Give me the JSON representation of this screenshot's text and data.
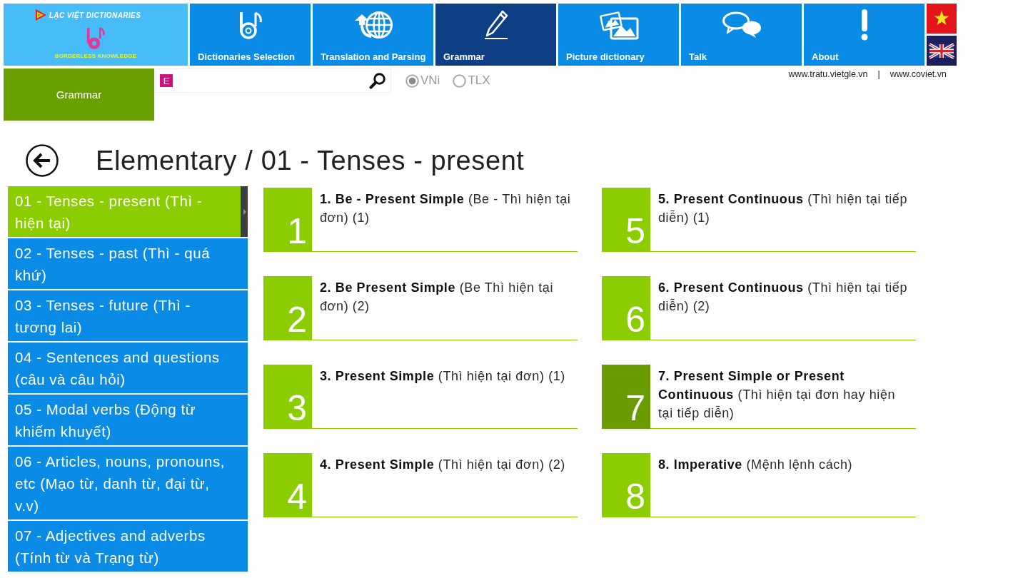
{
  "header": {
    "logo": {
      "title": "LẠC VIỆT DICTIONARIES",
      "tagline": "BORDERLESS KNOWLEDGE"
    },
    "nav_tiles": [
      {
        "kind": "dictionaries",
        "label": "Dictionaries Selection",
        "selected": false
      },
      {
        "kind": "translation",
        "label": "Translation and Parsing",
        "selected": false
      },
      {
        "kind": "grammar",
        "label": "Grammar",
        "selected": true
      },
      {
        "kind": "pictures",
        "label": "Picture dictionary",
        "selected": false
      },
      {
        "kind": "talk",
        "label": "Talk",
        "selected": false
      },
      {
        "kind": "about",
        "label": "About",
        "selected": false
      }
    ],
    "languages": [
      {
        "kind": "vn"
      },
      {
        "kind": "uk"
      }
    ]
  },
  "section_tile": {
    "label": "Grammar"
  },
  "search": {
    "badge": "E",
    "options": [
      {
        "label": "VNi",
        "selected": true
      },
      {
        "label": "TLX",
        "selected": false
      }
    ]
  },
  "links": {
    "items": [
      "www.tratu.vietgle.vn",
      "www.coviet.vn"
    ],
    "separator": "|"
  },
  "page_title": "Elementary / 01 - Tenses - present",
  "topics": [
    {
      "label": "01 - Tenses - present (Thì - hiện tại)",
      "selected": true
    },
    {
      "label": "02 - Tenses - past (Thì - quá khứ)",
      "selected": false
    },
    {
      "label": "03 - Tenses - future (Thì - tương lai)",
      "selected": false
    },
    {
      "label": "04 - Sentences and questions (câu và câu hỏi)",
      "selected": false
    },
    {
      "label": "05 - Modal verbs (Động từ khiếm khuyết)",
      "selected": false
    },
    {
      "label": "06 - Articles, nouns, pronouns, etc (Mạo từ, danh từ, đại từ, v.v)",
      "selected": false
    },
    {
      "label": "07 - Adjectives and adverbs (Tính từ và Trạng từ)",
      "selected": false
    }
  ],
  "lessons": [
    {
      "number": "1",
      "title": "**1. Be - Present Simple** (Be - Thì hiện tại đơn) (1)",
      "selected": false
    },
    {
      "number": "2",
      "title": "**2. Be Present Simple** (Be Thì hiện tại đơn) (2)",
      "selected": false
    },
    {
      "number": "3",
      "title": "**3. Present Simple** (Thì hiện tại đơn) (1)",
      "selected": false
    },
    {
      "number": "4",
      "title": "**4. Present Simple** (Thì hiện tại đơn) (2)",
      "selected": false
    },
    {
      "number": "5",
      "title": "**5. Present Continuous** (Thì hiện tại tiếp diễn) (1)",
      "selected": false
    },
    {
      "number": "6",
      "title": "**6. Present Continuous** (Thì hiện tại tiếp diễn) (2)",
      "selected": false
    },
    {
      "number": "7",
      "title": "**7. Present Simple or Present Continuous** (Thì hiện tại đơn hay hiện tại tiếp diễn)",
      "selected": true
    },
    {
      "number": "8",
      "title": "**8. Imperative** (Mệnh lệnh cách)",
      "selected": false
    }
  ]
}
